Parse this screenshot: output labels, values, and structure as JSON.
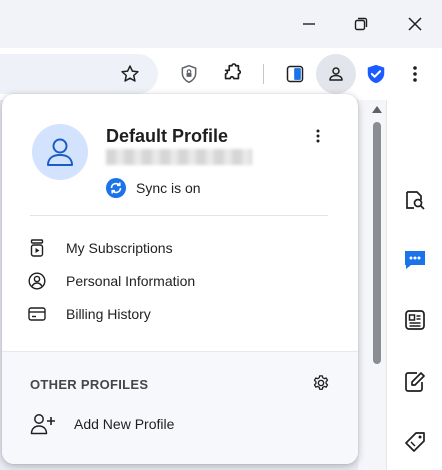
{
  "window": {
    "minimize_label": "",
    "maximize_label": "",
    "close_label": ""
  },
  "toolbar": {
    "icons": [
      "bookmark-star-icon",
      "password-manager-icon",
      "extensions-icon",
      "reading-mode-icon",
      "profile-icon",
      "vpn-shield-icon",
      "menu-kebab-icon"
    ]
  },
  "profile": {
    "name": "Default Profile",
    "sync_status": "Sync is on"
  },
  "menu": {
    "items": [
      {
        "label": "My Subscriptions",
        "icon": "subscription-icon"
      },
      {
        "label": "Personal Information",
        "icon": "person-circle-icon"
      },
      {
        "label": "Billing History",
        "icon": "credit-card-icon"
      }
    ]
  },
  "other_profiles": {
    "title": "OTHER PROFILES",
    "add_label": "Add New Profile"
  },
  "side_panel": {
    "icons": [
      "search-page-icon",
      "chat-icon",
      "news-icon",
      "notes-icon",
      "tag-icon"
    ]
  },
  "colors": {
    "accent": "#1a73e8",
    "avatar_bg": "#d3e3fd",
    "vpn_blue": "#1a5cff"
  }
}
